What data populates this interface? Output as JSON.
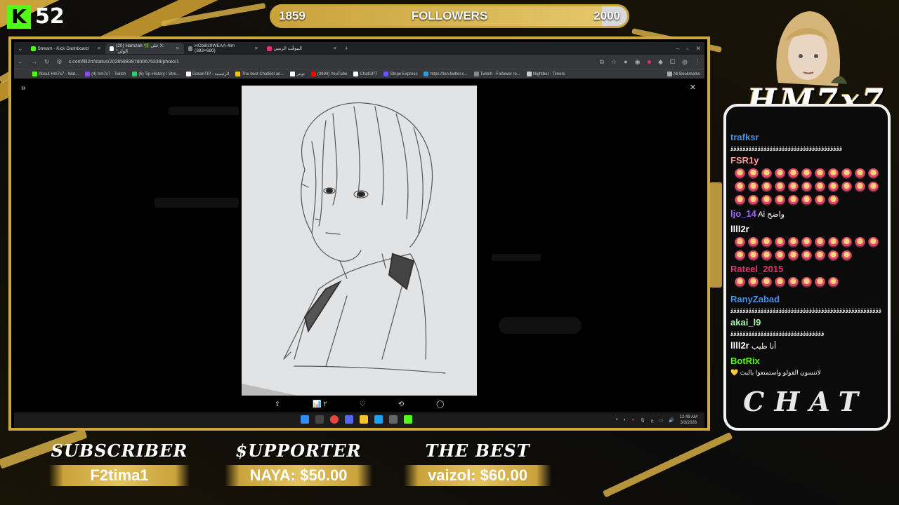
{
  "kick": {
    "count": "52",
    "logo": "K"
  },
  "followers": {
    "current": "1859",
    "label": "FOLLOWERS",
    "goal": "2000",
    "progress": 0.9295
  },
  "browser": {
    "tabs": [
      {
        "label": "Stream - Kick Dashboard",
        "icon_color": "#53fc18"
      },
      {
        "label": "(20) Hamzah 🌿 على X: \"الولي",
        "icon_color": "#ffffff"
      },
      {
        "label": "HCb8l29WEAA-4lm (383×680)",
        "icon_color": "#888888"
      },
      {
        "label": "الموقّت الزمني",
        "icon_color": "#e0336b"
      }
    ],
    "url": "x.com/lili2rr/status/2028588387800675339/photo/1",
    "bookmarks": [
      {
        "label": "About Hm7x7 - Wat...",
        "color": "#53fc18"
      },
      {
        "label": "(4) hm7x7 - Twitch",
        "color": "#9146ff"
      },
      {
        "label": "(6) Tip History / Stre...",
        "color": "#2ecc71"
      },
      {
        "label": "DokanTIP - الرئيسية",
        "color": "#ffffff"
      },
      {
        "label": "The best ChatBot an...",
        "color": "#f1c40f"
      },
      {
        "label": "تويتر",
        "color": "#ffffff"
      },
      {
        "label": "(3994) YouTube",
        "color": "#ff0000"
      },
      {
        "label": "ChatGPT",
        "color": "#ffffff"
      },
      {
        "label": "Stripe Express",
        "color": "#635bff"
      },
      {
        "label": "https://ton.twitter.c...",
        "color": "#3498db"
      },
      {
        "label": "Twitch - Follower re...",
        "color": "#888888"
      },
      {
        "label": "Nightbot - Timers",
        "color": "#cccccc"
      }
    ],
    "all_bookmarks": "All Bookmarks",
    "view_count": "٢",
    "clock_time": "12:49 AM",
    "clock_date": "3/3/2026",
    "lang": "ع"
  },
  "chat": {
    "brand": "HM7x7",
    "label": "CHAT",
    "messages": [
      {
        "user": "trafksr",
        "color": "#4a90e2",
        "text": "ﭬﭬﭬﭬﭬﭬﭬﭬﭬﭬﭬﭬﭬﭬﭬﭬﭬﭬﭬﭬﭬﭬﭬﭬﭬﭬﭬﭬﭬﭬﭬﭬﭬﭬﭬﭬﭬ",
        "emotes": 0
      },
      {
        "user": "FSR1y",
        "color": "#ff9a9a",
        "text": "",
        "emotes": 30
      },
      {
        "user": "ljo_14",
        "color": "#9b6bff",
        "text": "Ai واضح",
        "emotes": 0
      },
      {
        "user": "llll2r",
        "color": "#ffffff",
        "text": "",
        "emotes": 20
      },
      {
        "user": "Rateel_2015",
        "color": "#e0336b",
        "text": "",
        "emotes": 8
      },
      {
        "user": "RanyZabad",
        "color": "#4a90e2",
        "text": "ﭬﭬﭬﭬﭬﭬﭬﭬﭬﭬﭬﭬﭬﭬﭬﭬﭬﭬﭬﭬﭬﭬﭬﭬﭬﭬﭬﭬﭬﭬﭬﭬﭬﭬﭬﭬﭬﭬﭬﭬﭬﭬﭬﭬﭬﭬﭬﭬﭬﭬ",
        "emotes": 0
      },
      {
        "user": "akai_l9",
        "color": "#a7f3a7",
        "text": "ﭬﭬﭬﭬﭬﭬﭬﭬﭬﭬﭬﭬﭬﭬﭬﭬﭬﭬﭬﭬﭬﭬﭬﭬﭬﭬﭬﭬﭬﭬﭬ",
        "emotes": 0
      },
      {
        "user": "llll2r",
        "color": "#ffffff",
        "text": "أنا طيب",
        "emotes": 0
      },
      {
        "user": "BotRix",
        "color": "#53fc18",
        "text": "💛 لاتنسون الفولو واستمتعوا بالبث",
        "emotes": 0
      }
    ]
  },
  "bottom": {
    "subscriber": {
      "title": "SUBSCRIBER",
      "value": "F2tima1"
    },
    "supporter": {
      "title": "$UPPORTER",
      "value": "NAYA: $50.00"
    },
    "best": {
      "title": "THE BEST",
      "value": "vaizol: $60.00"
    }
  }
}
